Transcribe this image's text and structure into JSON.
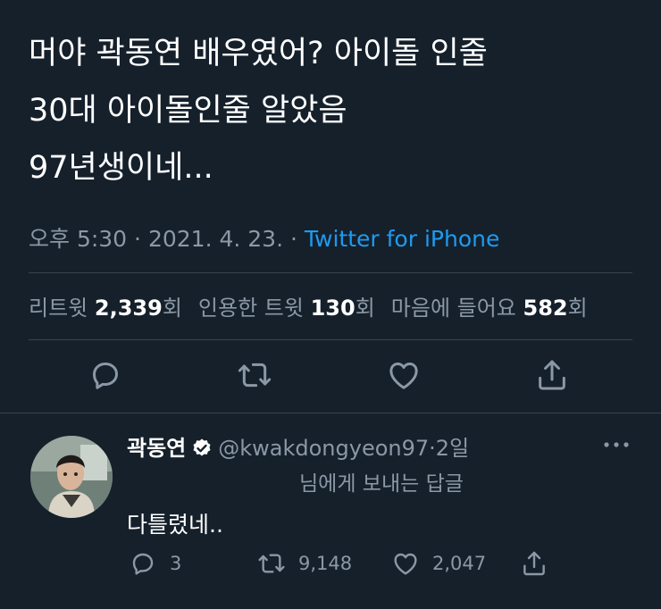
{
  "tweet": {
    "lines": [
      "머야 곽동연 배우였어? 아이돌 인줄",
      "30대 아이돌인줄 알았음",
      "97년생이네..."
    ],
    "time": "오후 5:30",
    "date": "2021. 4. 23.",
    "separator": "·",
    "source": "Twitter for iPhone"
  },
  "stats": {
    "retweets_label": "리트윗",
    "retweets_value": "2,339",
    "retweets_unit": "회",
    "quotes_label": "인용한 트윗",
    "quotes_value": "130",
    "quotes_unit": "회",
    "likes_label": "마음에 들어요",
    "likes_value": "582",
    "likes_unit": "회"
  },
  "actions": {
    "icons": [
      "reply-icon",
      "retweet-icon",
      "like-icon",
      "share-icon"
    ]
  },
  "reply": {
    "name": "곽동연",
    "handle": "@kwakdongyeon97",
    "dot": "·",
    "time": "2일",
    "reply_to": "님에게 보내는 답글",
    "text": "다틀렸네..",
    "reply_count": "3",
    "retweet_count": "9,148",
    "like_count": "2,047"
  },
  "colors": {
    "background": "#15202b",
    "text": "#ffffff",
    "muted": "#8b98a5",
    "accent": "#1d9bf0",
    "divider": "#38444d",
    "verified": "#ffffff"
  }
}
